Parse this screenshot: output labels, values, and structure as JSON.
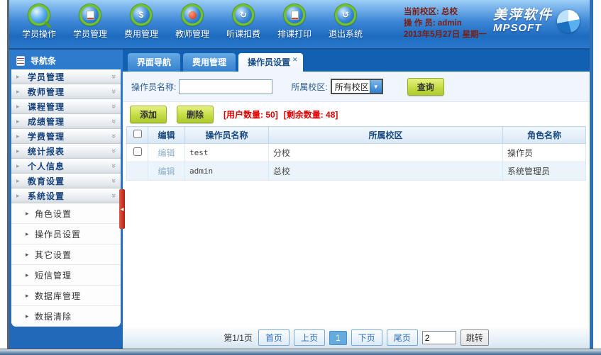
{
  "header": {
    "toolbar": [
      {
        "label": "学员操作",
        "icon": "student-search-icon"
      },
      {
        "label": "学员管理",
        "icon": "student-manage-icon"
      },
      {
        "label": "费用管理",
        "icon": "fee-manage-icon",
        "glyph": "$"
      },
      {
        "label": "教师管理",
        "icon": "teacher-manage-icon"
      },
      {
        "label": "听课扣费",
        "icon": "listen-deduct-icon",
        "glyph": "↻"
      },
      {
        "label": "排课打印",
        "icon": "schedule-print-icon"
      },
      {
        "label": "退出系统",
        "icon": "exit-system-icon",
        "glyph": "↺"
      }
    ],
    "info": {
      "line1": "当前校区: 总校",
      "line2": "操 作 员: admin",
      "line3": "2013年5月27日 星期一"
    },
    "logo": {
      "cn": "美萍软件",
      "en": "MPSOFT"
    }
  },
  "sidebar": {
    "title": "导航条",
    "items": [
      {
        "label": "学员管理"
      },
      {
        "label": "教师管理"
      },
      {
        "label": "课程管理"
      },
      {
        "label": "成绩管理"
      },
      {
        "label": "学费管理"
      },
      {
        "label": "统计报表"
      },
      {
        "label": "个人信息"
      },
      {
        "label": "教育设置"
      },
      {
        "label": "系统设置"
      }
    ],
    "subitems": [
      {
        "label": "角色设置"
      },
      {
        "label": "操作员设置"
      },
      {
        "label": "其它设置"
      },
      {
        "label": "短信管理"
      },
      {
        "label": "数据库管理"
      },
      {
        "label": "数据清除"
      }
    ]
  },
  "tabs": [
    {
      "label": "界面导航",
      "active": false
    },
    {
      "label": "费用管理",
      "active": false
    },
    {
      "label": "操作员设置",
      "active": true
    }
  ],
  "filter": {
    "name_label": "操作员名称:",
    "name_value": "",
    "campus_label": "所属校区:",
    "campus_value": "所有校区",
    "search_button": "查询"
  },
  "actions": {
    "add_button": "添加",
    "delete_button": "删除",
    "user_count": "[用户数量: 50]",
    "remaining_count": "[剩余数量: 48]"
  },
  "table": {
    "headers": {
      "edit": "编辑",
      "name": "操作员名称",
      "campus": "所属校区",
      "role": "角色名称"
    },
    "rows": [
      {
        "edit": "编辑",
        "name": "test",
        "campus": "分校",
        "role": "操作员",
        "has_checkbox": true
      },
      {
        "edit": "编辑",
        "name": "admin",
        "campus": "总校",
        "role": "系统管理员",
        "has_checkbox": false
      }
    ]
  },
  "pagination": {
    "info": "第1/1页",
    "first": "首页",
    "prev": "上页",
    "current": "1",
    "next": "下页",
    "last": "尾页",
    "jump_value": "2",
    "jump_button": "跳转"
  },
  "icons": {
    "close": "✕",
    "dropdown": "▼",
    "collapse": "◀",
    "arrow_right": "▸",
    "chevron_double": "»"
  },
  "colors": {
    "header_blue": "#2b7ad0",
    "tabstrip_blue": "#1160b2",
    "sidebar_blue": "#2673c8",
    "button_green": "#c5dc45",
    "alert_red": "#e00000",
    "nav_text_navy": "#16427c",
    "page_current_blue": "#66abde"
  }
}
